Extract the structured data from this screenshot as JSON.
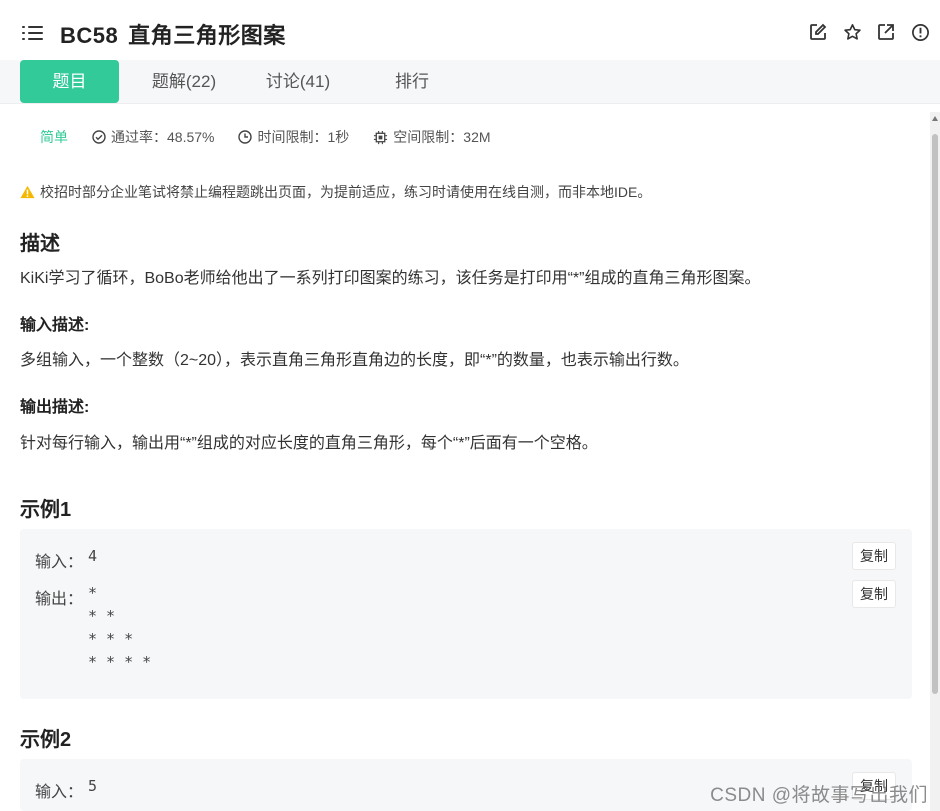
{
  "header": {
    "code": "BC58",
    "title": "直角三角形图案",
    "icons": [
      "edit-icon",
      "star-icon",
      "external-link-icon",
      "info-icon"
    ]
  },
  "tabs": [
    {
      "label": "题目",
      "active": true
    },
    {
      "label": "题解(22)",
      "active": false
    },
    {
      "label": "讨论(41)",
      "active": false
    },
    {
      "label": "排行",
      "active": false
    }
  ],
  "meta": {
    "difficulty": "简单",
    "pass_rate": "通过率：48.57%",
    "time_limit": "时间限制：1秒",
    "space_limit": "空间限制：32M"
  },
  "notice": "校招时部分企业笔试将禁止编程题跳出页面，为提前适应，练习时请使用在线自测，而非本地IDE。",
  "description": {
    "heading": "描述",
    "text": "KiKi学习了循环，BoBo老师给他出了一系列打印图案的练习，该任务是打印用“*”组成的直角三角形图案。"
  },
  "input_desc": {
    "heading": "输入描述:",
    "text": "多组输入，一个整数（2~20），表示直角三角形直角边的长度，即“*”的数量，也表示输出行数。"
  },
  "output_desc": {
    "heading": "输出描述:",
    "text": "针对每行输入，输出用“*”组成的对应长度的直角三角形，每个“*”后面有一个空格。"
  },
  "examples": [
    {
      "heading": "示例1",
      "input_label": "输入：",
      "input": "4",
      "output_label": "输出：",
      "output": "* \n* * \n* * * \n* * * * ",
      "copy_label": "复制"
    },
    {
      "heading": "示例2",
      "input_label": "输入：",
      "input": "5",
      "copy_label": "复制"
    }
  ],
  "watermark": "CSDN @将故事写出我们",
  "colors": {
    "accent": "#32ca99",
    "warning": "#f5b800"
  }
}
